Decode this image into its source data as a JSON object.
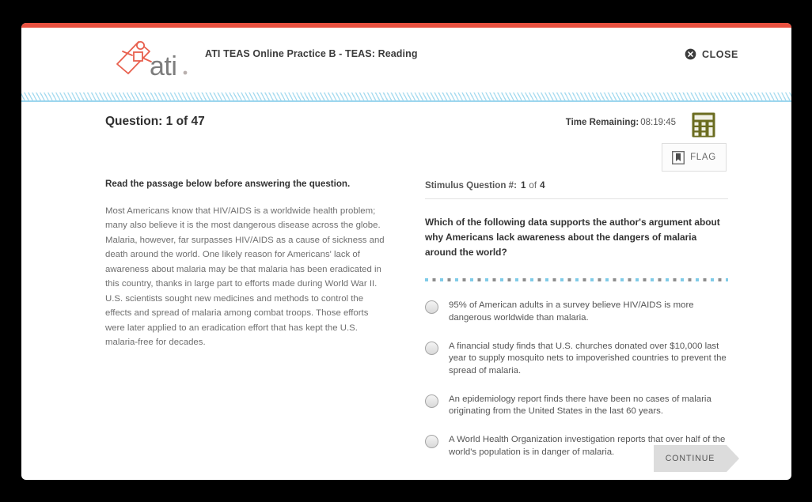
{
  "header": {
    "title": "ATI TEAS Online Practice B - TEAS: Reading",
    "logo_text": "ati.",
    "close_label": "CLOSE",
    "close_icon": "close-circle-icon",
    "accent_color": "#e8503f"
  },
  "status": {
    "question_counter": "Question: 1 of 47",
    "time_remaining_label": "Time Remaining:",
    "time_remaining_value": "08:19:45",
    "calculator_icon": "calculator-icon",
    "calculator_color": "#6b6c20"
  },
  "flag": {
    "label": "FLAG",
    "icon": "bookmark-flag-icon"
  },
  "passage": {
    "instruction": "Read the passage below before answering the question.",
    "body": "Most Americans know that HIV/AIDS is a worldwide health problem; many also believe it is the most dangerous disease across the globe. Malaria, however, far surpasses HIV/AIDS as a cause of sickness and death around the world. One likely reason for Americans' lack of awareness about malaria may be that malaria has been eradicated in this country, thanks in large part to efforts made during World War II. U.S. scientists sought new medicines and methods to control the effects and spread of malaria among combat troops. Those efforts were later applied to an eradication effort that has kept the U.S. malaria-free for decades."
  },
  "question": {
    "stimulus_label": "Stimulus Question #:",
    "stimulus_index": "1",
    "stimulus_of": "of",
    "stimulus_total": "4",
    "stem": "Which of the following data supports the author's argument about why Americans lack awareness about the dangers of malaria around the world?",
    "options": [
      {
        "id": "option-a",
        "text": "95% of American adults in a survey believe HIV/AIDS is more dangerous worldwide than malaria.",
        "selected": false
      },
      {
        "id": "option-b",
        "text": "A financial study finds that U.S. churches donated over $10,000 last year to supply mosquito nets to impoverished countries to prevent the spread of malaria.",
        "selected": false
      },
      {
        "id": "option-c",
        "text": "An epidemiology report finds there have been no cases of malaria originating from the United States in the last 60 years.",
        "selected": false
      },
      {
        "id": "option-d",
        "text": "A World Health Organization investigation reports that over half of the world's population is in danger of malaria.",
        "selected": false
      }
    ]
  },
  "footer": {
    "continue_label": "CONTINUE"
  }
}
